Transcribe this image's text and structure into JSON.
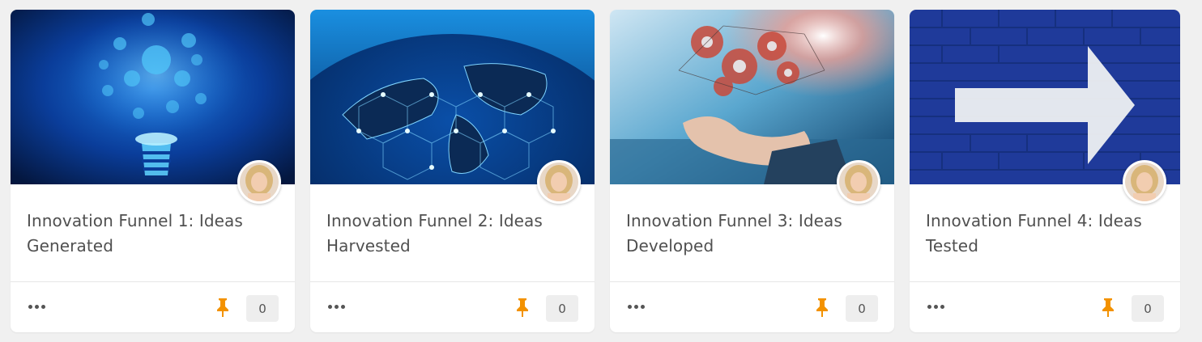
{
  "cards": [
    {
      "title": "Innovation Funnel 1: Ideas Generated",
      "image_icon": "lightbulb-network-image",
      "count": "0"
    },
    {
      "title": "Innovation Funnel 2: Ideas Harvested",
      "image_icon": "globe-network-image",
      "count": "0"
    },
    {
      "title": "Innovation Funnel 3: Ideas Developed",
      "image_icon": "hand-gears-image",
      "count": "0"
    },
    {
      "title": "Innovation Funnel 4: Ideas Tested",
      "image_icon": "arrow-brick-wall-image",
      "count": "0"
    }
  ],
  "colors": {
    "pin": "#f39200",
    "background": "#f0f0f0",
    "title_text": "#505050"
  }
}
